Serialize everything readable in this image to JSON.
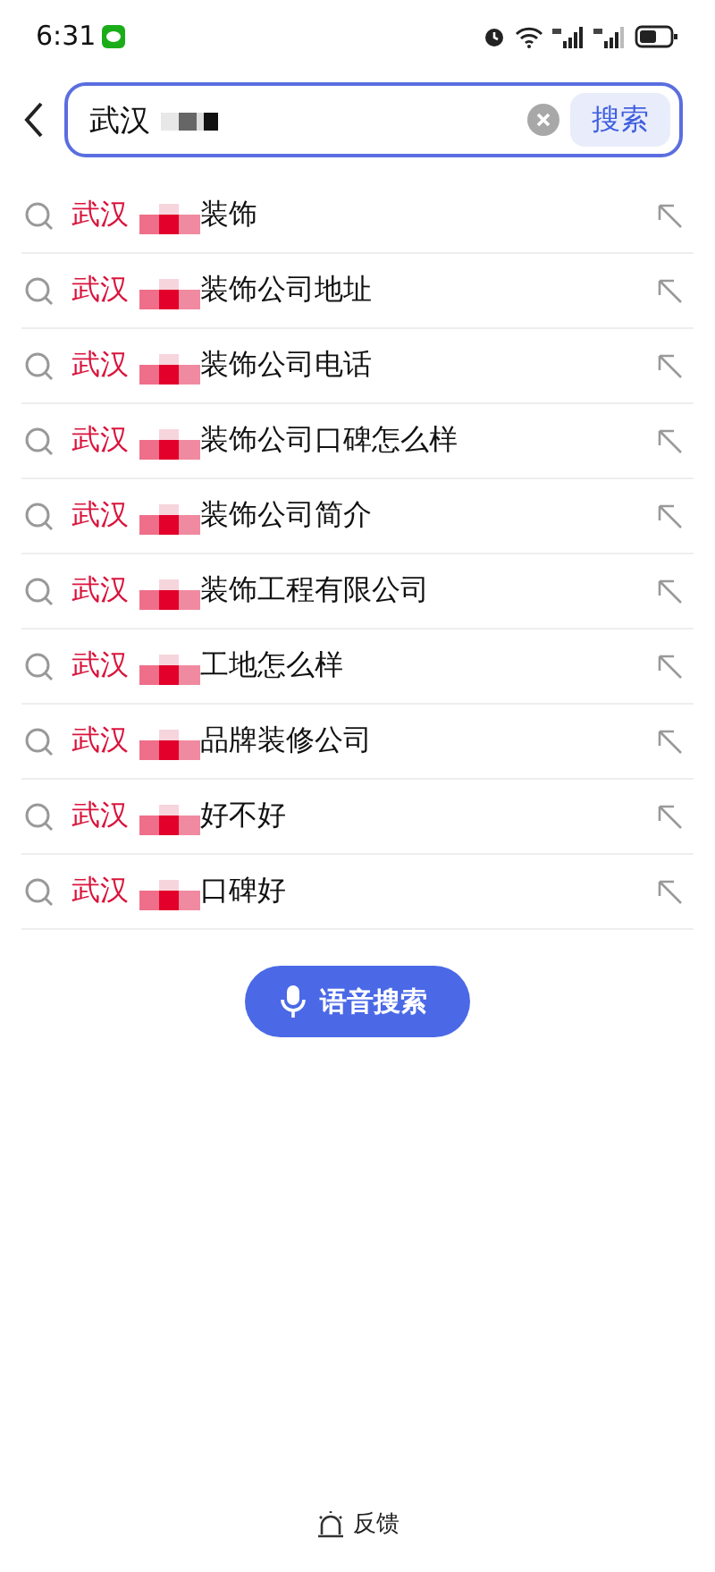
{
  "status_bar": {
    "time": "6:31"
  },
  "search": {
    "value": "武汉",
    "button": "搜索"
  },
  "suggestions": [
    {
      "highlight": "武汉",
      "rest": "装饰"
    },
    {
      "highlight": "武汉",
      "rest": "装饰公司地址"
    },
    {
      "highlight": "武汉",
      "rest": "装饰公司电话"
    },
    {
      "highlight": "武汉",
      "rest": "装饰公司口碑怎么样"
    },
    {
      "highlight": "武汉",
      "rest": "装饰公司简介"
    },
    {
      "highlight": "武汉",
      "rest": "装饰工程有限公司"
    },
    {
      "highlight": "武汉",
      "rest": "工地怎么样"
    },
    {
      "highlight": "武汉",
      "rest": "品牌装修公司"
    },
    {
      "highlight": "武汉",
      "rest": "好不好"
    },
    {
      "highlight": "武汉",
      "rest": "口碑好"
    }
  ],
  "voice_button": "语音搜索",
  "feedback": "反馈"
}
